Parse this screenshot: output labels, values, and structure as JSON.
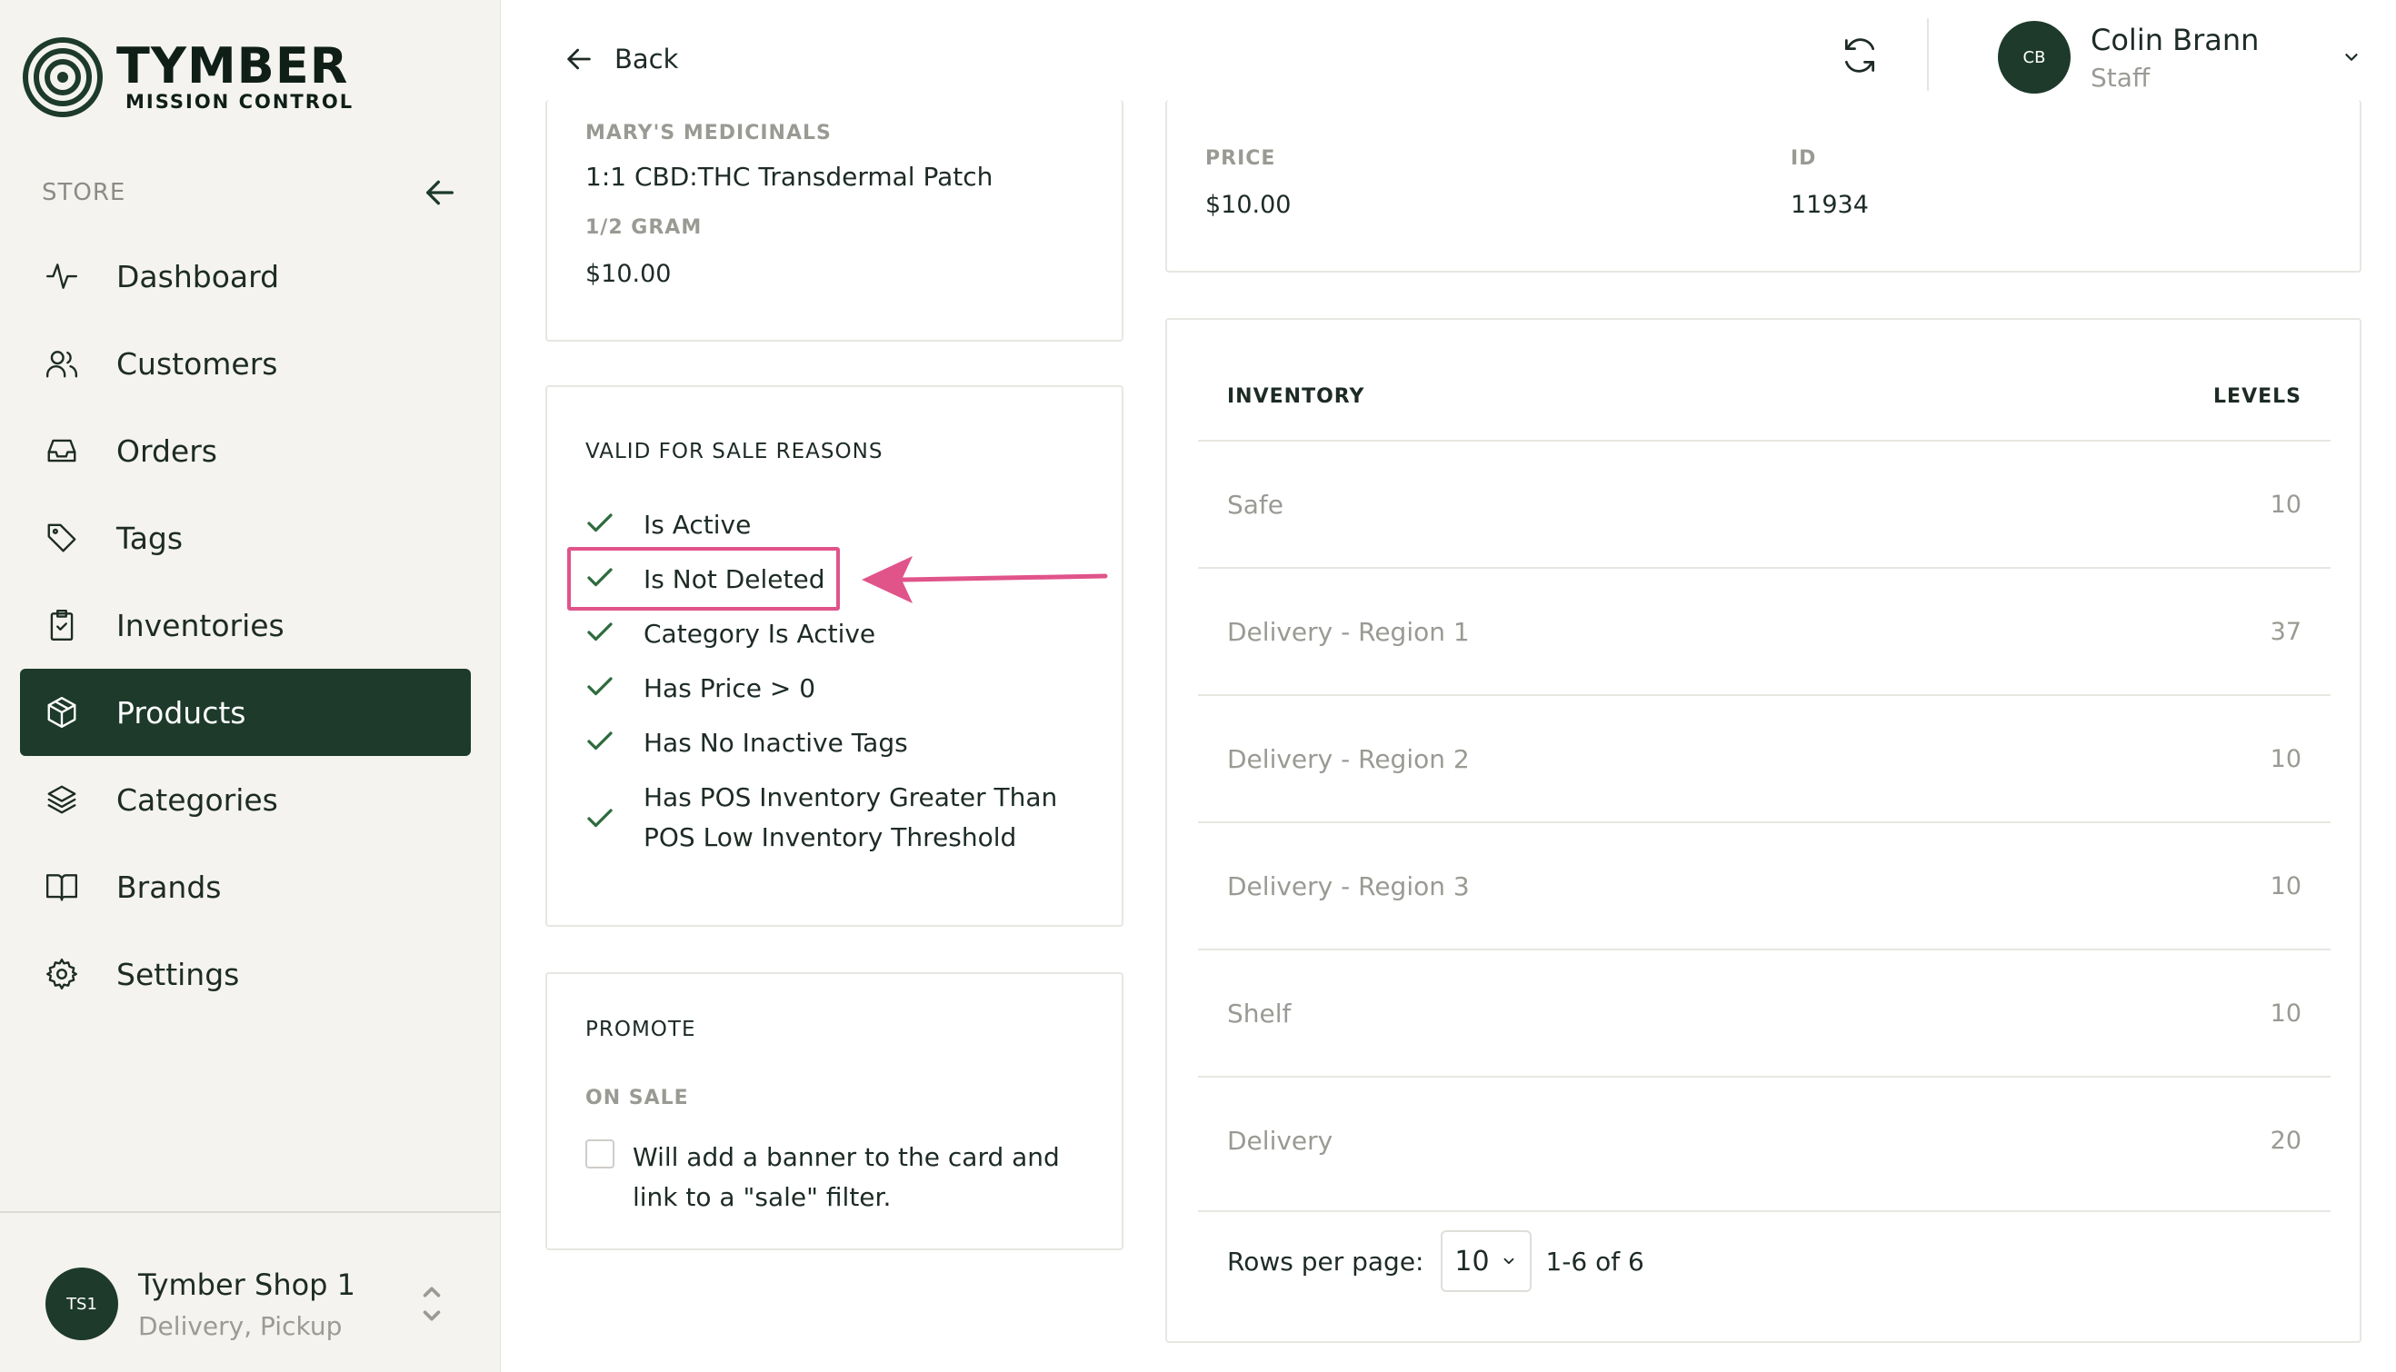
{
  "brand": {
    "title": "TYMBER",
    "subtitle": "MISSION CONTROL"
  },
  "sidebar": {
    "section_label": "STORE",
    "items": [
      {
        "label": "Dashboard",
        "icon": "activity-icon"
      },
      {
        "label": "Customers",
        "icon": "users-icon"
      },
      {
        "label": "Orders",
        "icon": "inbox-icon"
      },
      {
        "label": "Tags",
        "icon": "tag-icon"
      },
      {
        "label": "Inventories",
        "icon": "clipboard-check-icon"
      },
      {
        "label": "Products",
        "icon": "box-icon",
        "active": true
      },
      {
        "label": "Categories",
        "icon": "layers-icon"
      },
      {
        "label": "Brands",
        "icon": "book-open-icon"
      },
      {
        "label": "Settings",
        "icon": "gear-icon"
      }
    ],
    "shop": {
      "initials": "TS1",
      "name": "Tymber Shop 1",
      "modes": "Delivery, Pickup"
    }
  },
  "header": {
    "back_label": "Back",
    "user": {
      "initials": "CB",
      "name": "Colin Brann",
      "role": "Staff"
    }
  },
  "product_card": {
    "brand": "MARY'S MEDICINALS",
    "name": "1:1 CBD:THC Transdermal Patch",
    "size": "1/2 GRAM",
    "price": "$10.00"
  },
  "reasons": {
    "title": "VALID FOR SALE REASONS",
    "items": [
      "Is Active",
      "Is Not Deleted",
      "Category Is Active",
      "Has Price > 0",
      "Has No Inactive Tags",
      "Has POS Inventory Greater Than POS Low Inventory Threshold"
    ]
  },
  "promote": {
    "title": "PROMOTE",
    "on_sale_label": "ON SALE",
    "on_sale_desc": "Will add a banner to the card and link to a \"sale\" filter.",
    "on_sale_checked": false
  },
  "price_card": {
    "price_label": "PRICE",
    "price_value": "$10.00",
    "id_label": "ID",
    "id_value": "11934"
  },
  "inventory": {
    "col_name": "INVENTORY",
    "col_levels": "LEVELS",
    "rows": [
      {
        "name": "Safe",
        "level": "10"
      },
      {
        "name": "Delivery - Region 1",
        "level": "37"
      },
      {
        "name": "Delivery - Region 2",
        "level": "10"
      },
      {
        "name": "Delivery - Region 3",
        "level": "10"
      },
      {
        "name": "Shelf",
        "level": "10"
      },
      {
        "name": "Delivery",
        "level": "20"
      }
    ],
    "rows_per_page_label": "Rows per page:",
    "rows_per_page": "10",
    "range": "1-6 of 6"
  },
  "colors": {
    "primary": "#1d3a2b",
    "check": "#2e6b3e",
    "highlight": "#e0548a"
  }
}
